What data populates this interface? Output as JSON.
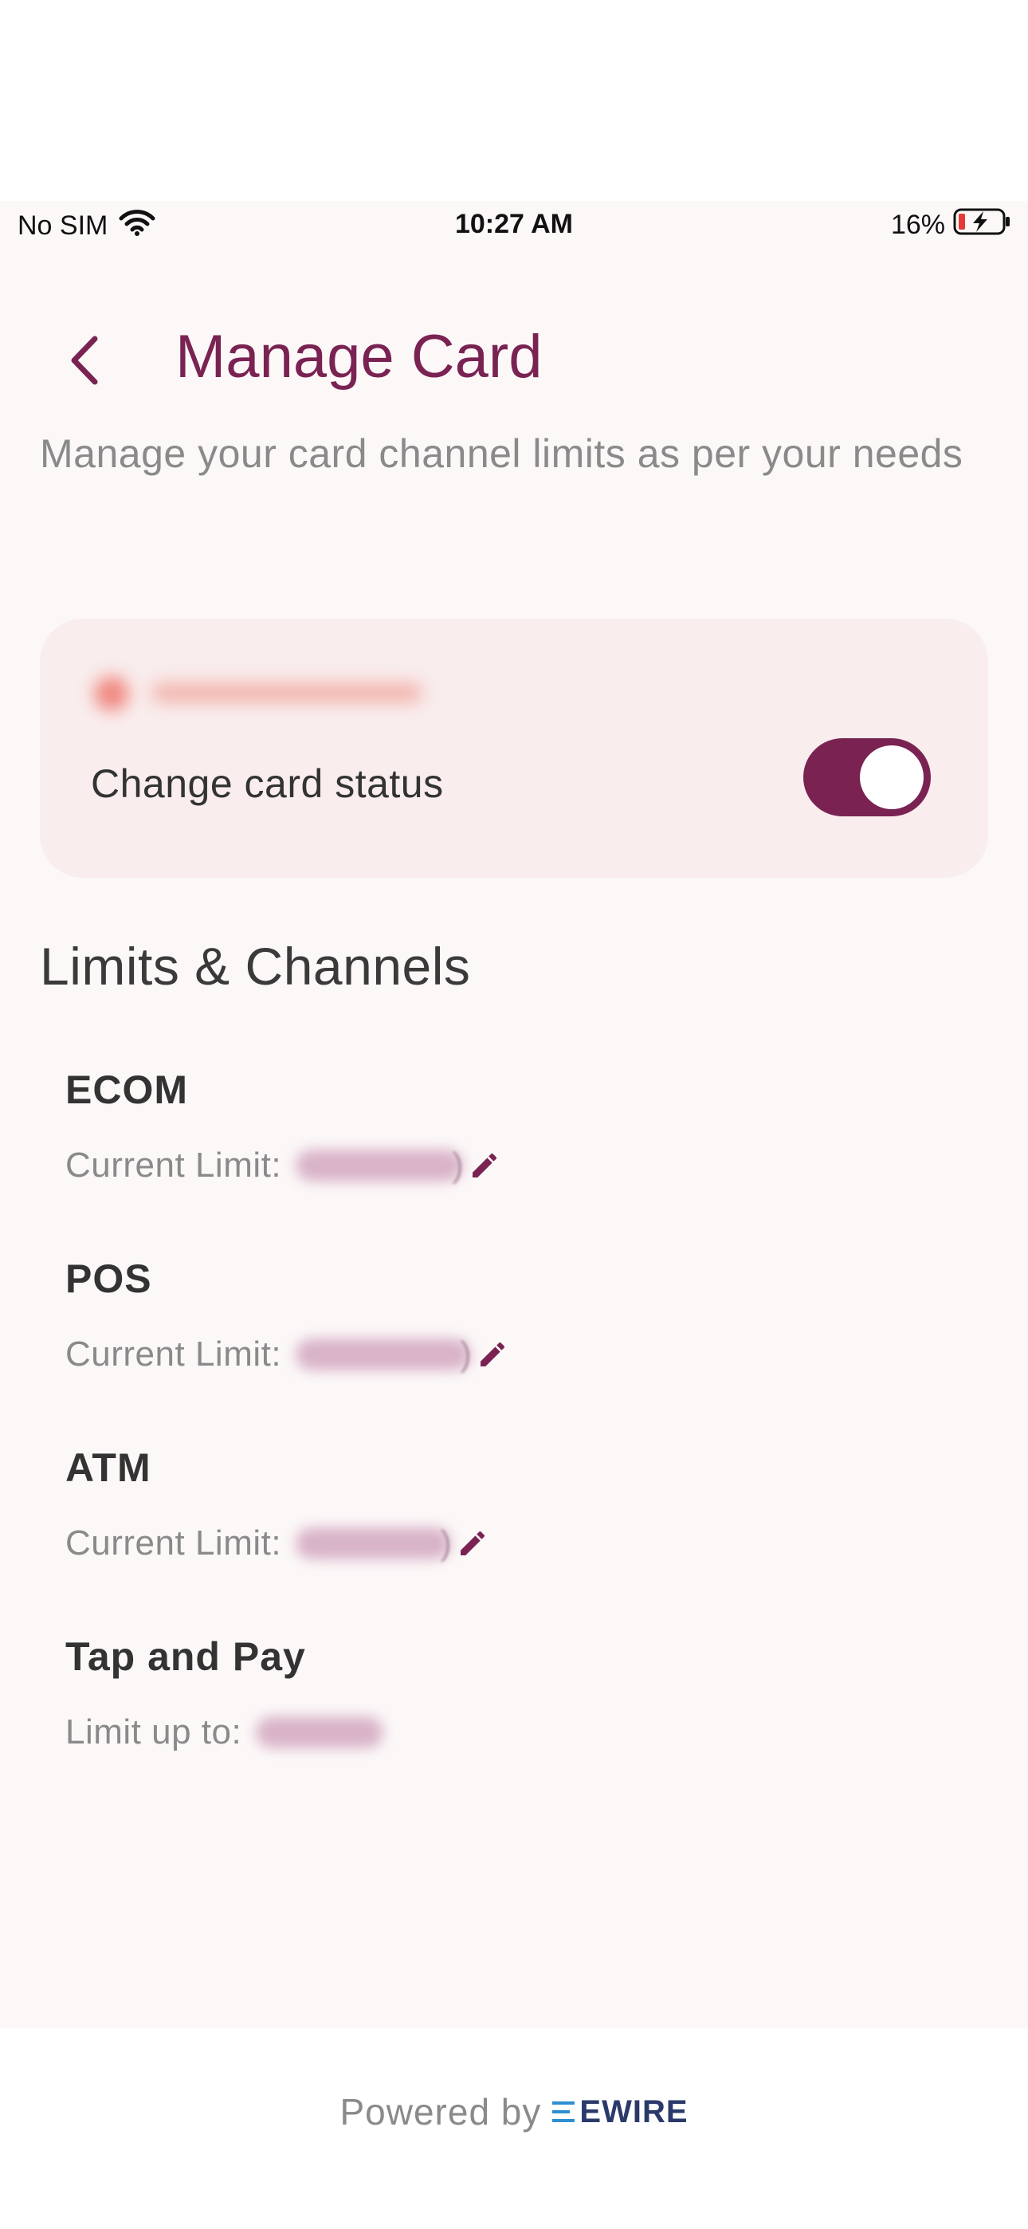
{
  "status_bar": {
    "carrier": "No SIM",
    "time": "10:27 AM",
    "battery": "16%"
  },
  "header": {
    "title": "Manage Card",
    "subtitle": "Manage your card channel limits as per your needs"
  },
  "card_status": {
    "label": "Change card status",
    "toggle_on": true
  },
  "limits": {
    "section_title": "Limits & Channels",
    "channels": [
      {
        "name": "ECOM",
        "limit_label": "Current Limit:"
      },
      {
        "name": "POS",
        "limit_label": "Current Limit:"
      },
      {
        "name": "ATM",
        "limit_label": "Current Limit:"
      },
      {
        "name": "Tap and Pay",
        "limit_label": "Limit up to:"
      }
    ]
  },
  "footer": {
    "powered_by": "Powered by",
    "logo_text": "EWIRE"
  },
  "colors": {
    "accent": "#7a2353",
    "card_bg": "#f9eded",
    "page_bg": "#fcf8f8",
    "logo_blue": "#2e8fd0",
    "logo_navy": "#2b3a6b"
  },
  "icons": {
    "back": "chevron-left-icon",
    "edit": "pencil-icon",
    "wifi": "wifi-icon",
    "battery": "battery-charging-icon"
  }
}
